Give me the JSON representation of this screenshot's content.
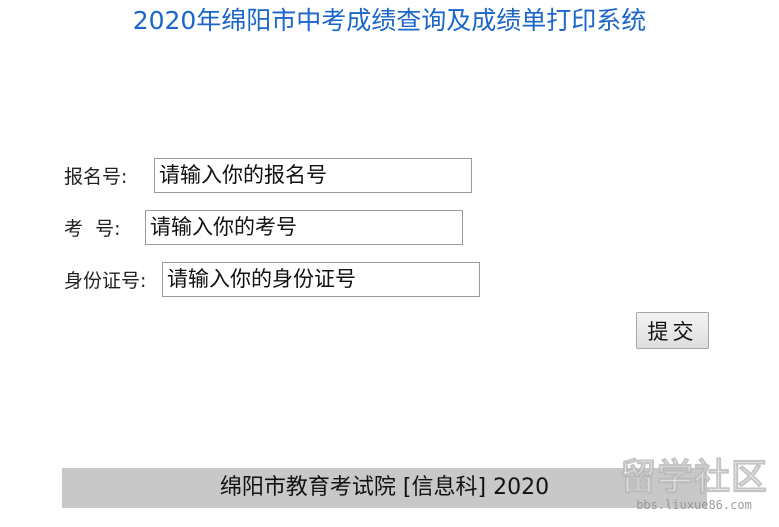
{
  "header": {
    "title": "2020年绵阳市中考成绩查询及成绩单打印系统"
  },
  "form": {
    "fields": [
      {
        "label": "报名号:",
        "placeholder": "请输入你的报名号"
      },
      {
        "label": "考  号:",
        "placeholder": "请输入你的考号"
      },
      {
        "label": "身份证号:",
        "placeholder": "请输入你的身份证号"
      }
    ],
    "submit_label": "提交"
  },
  "footer": {
    "text": "绵阳市教育考试院 [信息科] 2020"
  },
  "watermark": {
    "main": "留学社区",
    "sub": "bbs.liuxue86.com"
  },
  "colors": {
    "title": "#1a66c9",
    "footer_bg": "#c8c8c8"
  }
}
